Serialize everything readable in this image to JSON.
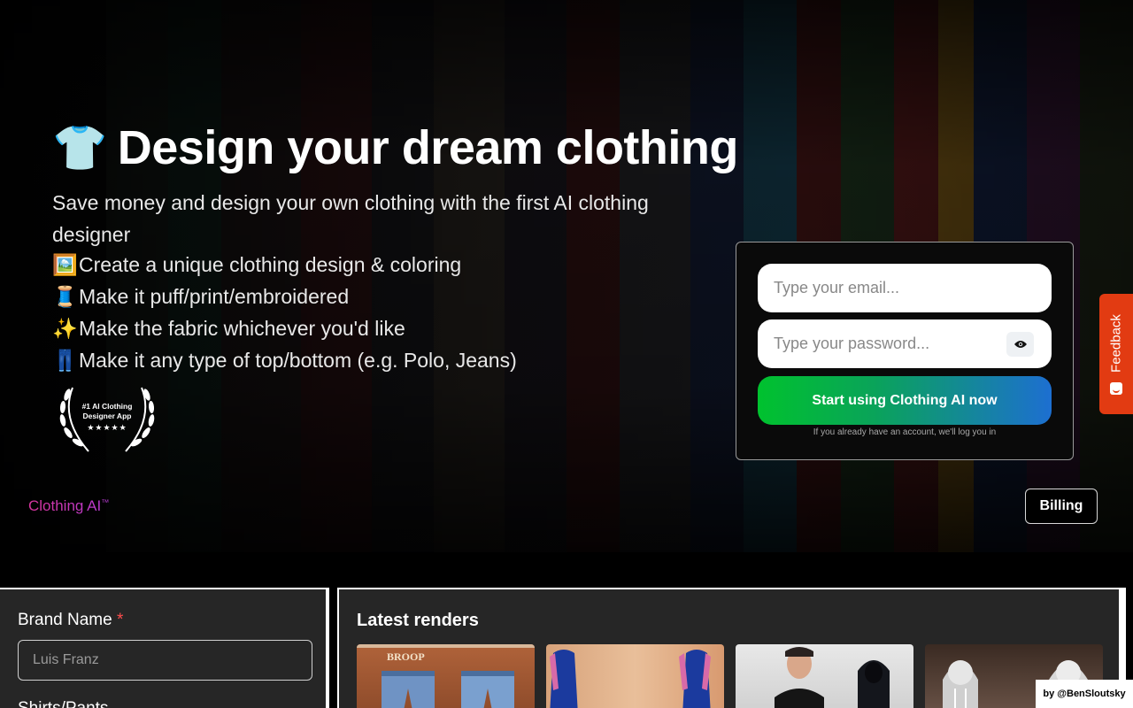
{
  "hero": {
    "headline_icon": "👕",
    "headline": "Design your dream clothing",
    "subtitle": "Save money and design your own clothing with the first AI clothing designer",
    "features": [
      {
        "icon": "🖼️",
        "text": "Create a unique clothing design & coloring"
      },
      {
        "icon": "🧵",
        "text": "Make it puff/print/embroidered"
      },
      {
        "icon": "✨",
        "text": "Make the fabric whichever you'd like"
      },
      {
        "icon": "👖",
        "text": "Make it any type of top/bottom (e.g. Polo, Jeans)"
      }
    ],
    "award": {
      "line1": "#1 AI Clothing",
      "line2": "Designer App",
      "stars": "★★★★★"
    }
  },
  "brand": {
    "name": "Clothing AI",
    "mark": "™"
  },
  "nav": {
    "billing_label": "Billing"
  },
  "login": {
    "email_placeholder": "Type your email...",
    "password_placeholder": "Type your password...",
    "submit_label": "Start using Clothing AI now",
    "note": "If you already have an account, we'll log you in"
  },
  "feedback": {
    "label": "Feedback"
  },
  "form": {
    "brand_name_label": "Brand Name",
    "required_mark": "*",
    "brand_name_placeholder": "Luis Franz",
    "next_label": "Shirts/Pants"
  },
  "renders": {
    "title": "Latest renders",
    "items": [
      {
        "caption": "BROOP"
      },
      {
        "caption": ""
      },
      {
        "caption": ""
      },
      {
        "caption": ""
      }
    ]
  },
  "credit": "by @BenSloutsky",
  "colors": {
    "brand_gradient": [
      "#d7359d",
      "#b43bd3"
    ],
    "cta_gradient": [
      "#00c22e",
      "#1d6fd1"
    ],
    "feedback": "#e23b12",
    "panel_bg": "#262626"
  }
}
